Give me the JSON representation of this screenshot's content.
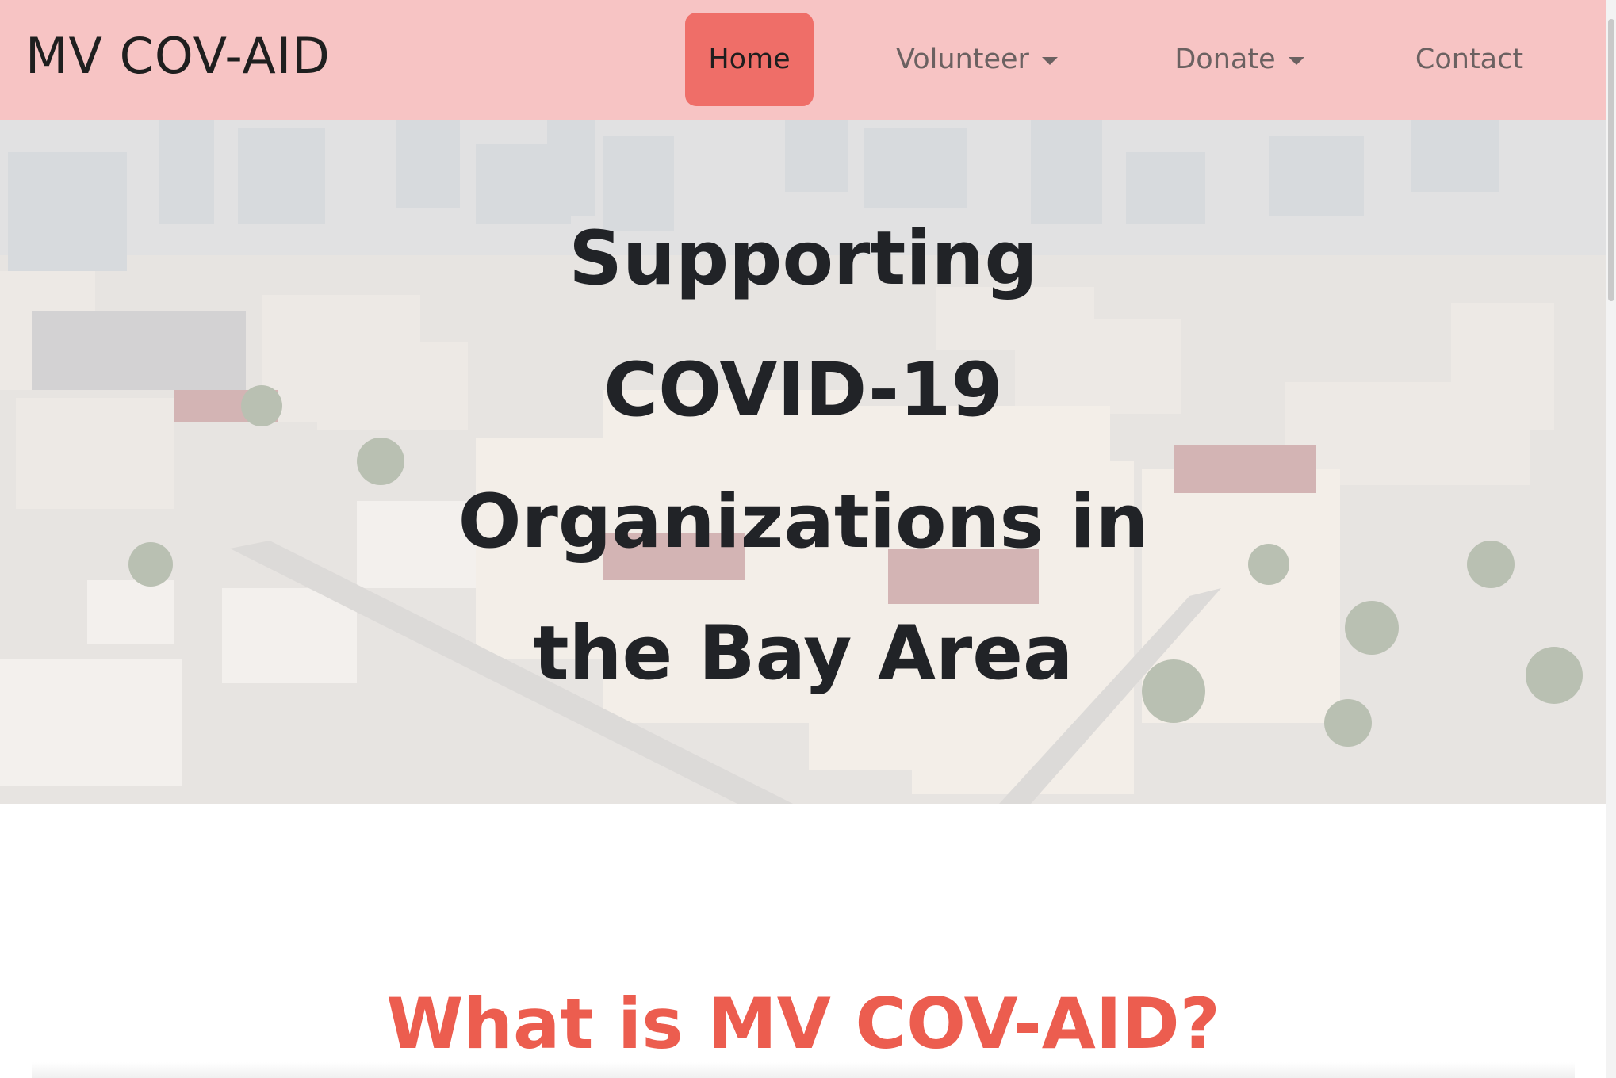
{
  "brand": {
    "name": "MV COV-AID"
  },
  "nav": {
    "home": "Home",
    "volunteer": "Volunteer",
    "donate": "Donate",
    "contact": "Contact"
  },
  "hero": {
    "lines": [
      "Supporting",
      "COVID-19",
      "Organizations in",
      "the Bay Area"
    ]
  },
  "about": {
    "title": "What is MV COV-AID?"
  },
  "colors": {
    "navbar_bg": "#f7c4c4",
    "active_nav_bg": "#ef6e68",
    "section_title": "#ec5d4f",
    "hero_text": "#212327"
  },
  "icons": {
    "volunteer_dropdown": "chevron-down-icon",
    "donate_dropdown": "chevron-down-icon"
  }
}
